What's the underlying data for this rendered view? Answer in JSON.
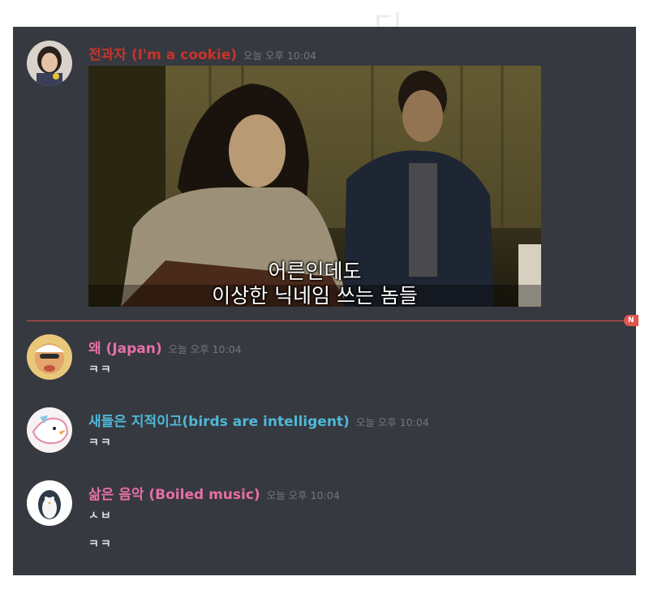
{
  "watermark": "디",
  "divider": {
    "new_label": "N",
    "color": "#d9514e"
  },
  "colors": {
    "background": "#36393f",
    "text": "#dcddde",
    "timestamp": "#72767d",
    "username_red": "#c8342b",
    "username_pink": "#e66fa7",
    "username_cyan": "#4fb8d9"
  },
  "messages": [
    {
      "username": "전과자 (I'm a cookie)",
      "timestamp": "오늘 오후 10:04",
      "name_color": "#c8342b",
      "image": {
        "subtitle_line1": "어른인데도",
        "subtitle_line2": "이상한 닉네임 쓰는 놈들"
      }
    },
    {
      "username": "왜 (Japan)",
      "timestamp": "오늘 오후 10:04",
      "name_color": "#e66fa7",
      "text": "ㅋㅋ"
    },
    {
      "username": "새들은 지적이고(birds are intelligent)",
      "timestamp": "오늘 오후 10:04",
      "name_color": "#4fb8d9",
      "text": "ㅋㅋ"
    },
    {
      "username": "삶은 음악 (Boiled music)",
      "timestamp": "오늘 오후 10:04",
      "name_color": "#e66fa7",
      "text": "ㅅㅂ",
      "text2": "ㅋㅋ"
    }
  ]
}
